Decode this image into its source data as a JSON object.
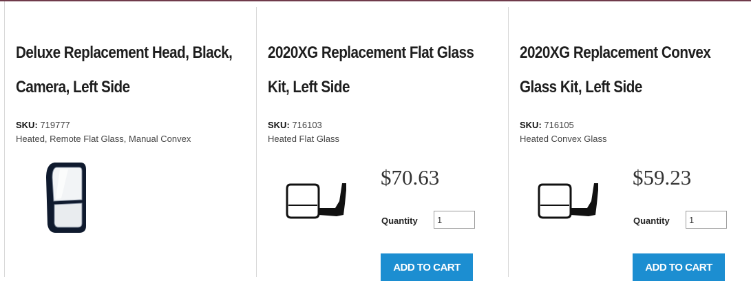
{
  "currency_color": "#1c8ed1",
  "products": [
    {
      "title_line1": "Deluxe Replacement Head, Black,",
      "title_line2": "Camera, Left Side",
      "sku_label": "SKU:",
      "sku": "719777",
      "description": "Heated, Remote Flat Glass, Manual Convex",
      "image_icon": "mirror-head-icon"
    },
    {
      "title_line1": "2020XG Replacement Flat Glass",
      "title_line2": "Kit, Left Side",
      "sku_label": "SKU:",
      "sku": "716103",
      "description": "Heated Flat Glass",
      "image_icon": "tow-mirror-icon",
      "price": "$70.63",
      "quantity_label": "Quantity",
      "quantity_value": "1",
      "cart_label": "ADD TO CART"
    },
    {
      "title_line1": "2020XG Replacement Convex",
      "title_line2": "Glass Kit, Left Side",
      "sku_label": "SKU:",
      "sku": "716105",
      "description": "Heated Convex Glass",
      "image_icon": "tow-mirror-icon",
      "price": "$59.23",
      "quantity_label": "Quantity",
      "quantity_value": "1",
      "cart_label": "ADD TO CART"
    }
  ]
}
